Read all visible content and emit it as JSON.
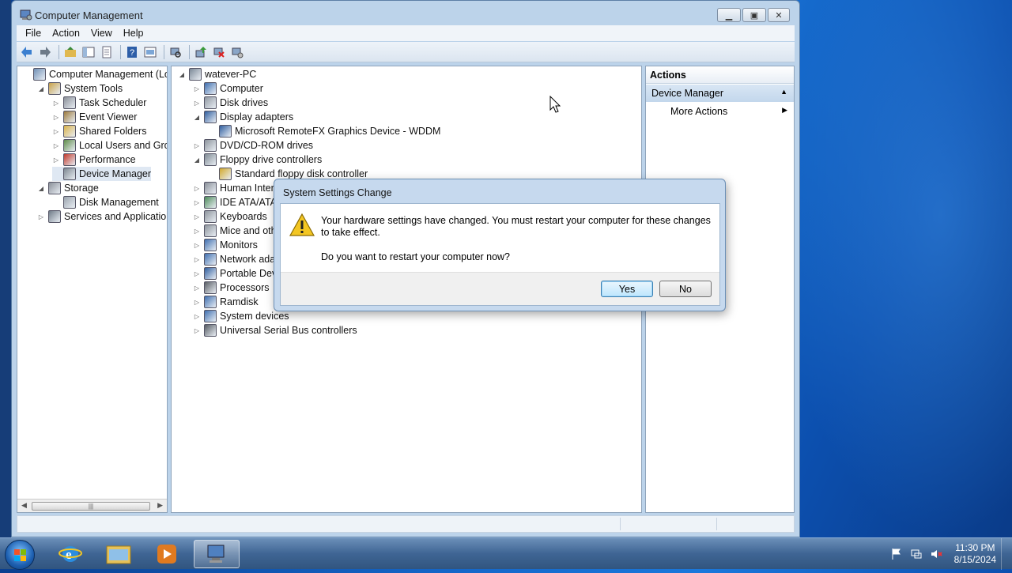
{
  "window": {
    "title": "Computer Management"
  },
  "menu": [
    "File",
    "Action",
    "View",
    "Help"
  ],
  "toolbar_icons": [
    "back-icon",
    "forward-icon",
    "up-folder-icon",
    "show-hide-tree-icon",
    "properties-icon",
    "help-icon",
    "view-icon",
    "scan-hardware-icon",
    "update-driver-icon",
    "disable-device-icon",
    "uninstall-device-icon"
  ],
  "left_tree": [
    {
      "label": "Computer Management (Local",
      "level": 0,
      "expander": "",
      "icon": "computer-management-icon",
      "color": "#6f8fb5",
      "selected": false
    },
    {
      "label": "System Tools",
      "level": 1,
      "expander": "◢",
      "icon": "system-tools-icon",
      "color": "#c9a24a",
      "selected": false
    },
    {
      "label": "Task Scheduler",
      "level": 2,
      "expander": "▷",
      "icon": "clock-icon",
      "color": "#8a8f98",
      "selected": false
    },
    {
      "label": "Event Viewer",
      "level": 2,
      "expander": "▷",
      "icon": "event-viewer-icon",
      "color": "#9c7a3c",
      "selected": false
    },
    {
      "label": "Shared Folders",
      "level": 2,
      "expander": "▷",
      "icon": "shared-folder-icon",
      "color": "#d9b24a",
      "selected": false
    },
    {
      "label": "Local Users and Groups",
      "level": 2,
      "expander": "▷",
      "icon": "users-icon",
      "color": "#5f8c4a",
      "selected": false
    },
    {
      "label": "Performance",
      "level": 2,
      "expander": "▷",
      "icon": "performance-icon",
      "color": "#c0392b",
      "selected": false
    },
    {
      "label": "Device Manager",
      "level": 2,
      "expander": "",
      "icon": "device-manager-icon",
      "color": "#7d8791",
      "selected": true
    },
    {
      "label": "Storage",
      "level": 1,
      "expander": "◢",
      "icon": "storage-icon",
      "color": "#8a8f98",
      "selected": false
    },
    {
      "label": "Disk Management",
      "level": 2,
      "expander": "",
      "icon": "disk-icon",
      "color": "#9aa3ad",
      "selected": false
    },
    {
      "label": "Services and Applications",
      "level": 1,
      "expander": "▷",
      "icon": "services-icon",
      "color": "#6f7b88",
      "selected": false
    }
  ],
  "device_tree": [
    {
      "label": "watever-PC",
      "level": 0,
      "expander": "◢",
      "icon": "pc-icon",
      "color": "#7b8896"
    },
    {
      "label": "Computer",
      "level": 1,
      "expander": "▷",
      "icon": "computer-icon",
      "color": "#3f6fb0"
    },
    {
      "label": "Disk drives",
      "level": 1,
      "expander": "▷",
      "icon": "disk-drive-icon",
      "color": "#9098a2"
    },
    {
      "label": "Display adapters",
      "level": 1,
      "expander": "◢",
      "icon": "display-adapter-icon",
      "color": "#2f5e9f"
    },
    {
      "label": "Microsoft RemoteFX Graphics Device - WDDM",
      "level": 2,
      "expander": "",
      "icon": "display-adapter-icon",
      "color": "#2f5e9f"
    },
    {
      "label": "DVD/CD-ROM drives",
      "level": 1,
      "expander": "▷",
      "icon": "dvd-drive-icon",
      "color": "#8d949c"
    },
    {
      "label": "Floppy drive controllers",
      "level": 1,
      "expander": "◢",
      "icon": "floppy-controller-icon",
      "color": "#7f8a93"
    },
    {
      "label": "Standard floppy disk controller",
      "level": 2,
      "expander": "",
      "icon": "floppy-warning-icon",
      "color": "#d2a92b"
    },
    {
      "label": "Human Inter",
      "level": 1,
      "expander": "▷",
      "icon": "hid-icon",
      "color": "#8a9099"
    },
    {
      "label": "IDE ATA/ATA",
      "level": 1,
      "expander": "▷",
      "icon": "ide-icon",
      "color": "#4d8a5a"
    },
    {
      "label": "Keyboards",
      "level": 1,
      "expander": "▷",
      "icon": "keyboard-icon",
      "color": "#8e959d"
    },
    {
      "label": "Mice and oth",
      "level": 1,
      "expander": "▷",
      "icon": "mouse-icon",
      "color": "#8e959d"
    },
    {
      "label": "Monitors",
      "level": 1,
      "expander": "▷",
      "icon": "monitor-icon",
      "color": "#3f6fb0"
    },
    {
      "label": "Network ada",
      "level": 1,
      "expander": "▷",
      "icon": "network-adapter-icon",
      "color": "#3f6fb0"
    },
    {
      "label": "Portable Dev",
      "level": 1,
      "expander": "▷",
      "icon": "portable-device-icon",
      "color": "#2f5e9f"
    },
    {
      "label": "Processors",
      "level": 1,
      "expander": "▷",
      "icon": "processor-icon",
      "color": "#5a5f66"
    },
    {
      "label": "Ramdisk",
      "level": 1,
      "expander": "▷",
      "icon": "ramdisk-icon",
      "color": "#3f6fb0"
    },
    {
      "label": "System devices",
      "level": 1,
      "expander": "▷",
      "icon": "system-device-icon",
      "color": "#3f6fb0"
    },
    {
      "label": "Universal Serial Bus controllers",
      "level": 1,
      "expander": "▷",
      "icon": "usb-icon",
      "color": "#555b62"
    }
  ],
  "actions": {
    "title": "Actions",
    "section": "Device Manager",
    "more": "More Actions"
  },
  "dialog": {
    "title": "System Settings Change",
    "message": "Your hardware settings have changed. You must restart your computer for these changes to take effect.",
    "question": "Do you want to restart your computer now?",
    "yes": "Yes",
    "no": "No"
  },
  "taskbar": {
    "apps": [
      "internet-explorer-icon",
      "file-explorer-icon",
      "media-player-icon",
      "computer-management-icon"
    ],
    "time": "11:30 PM",
    "date": "8/15/2024"
  },
  "colors": {
    "window_frame": "#bcd3ea",
    "dialog_frame": "#c6d9ee",
    "selection": "#dfe8f3",
    "desktop": "#1466c8"
  }
}
